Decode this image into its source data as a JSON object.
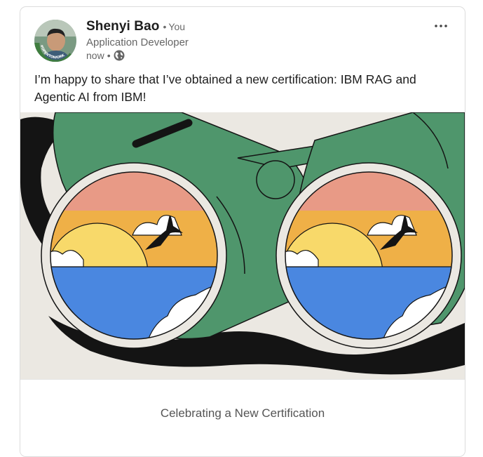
{
  "post": {
    "author": {
      "name": "Shenyi Bao",
      "separator": "•",
      "relation": "You",
      "headline": "Application Developer",
      "time": "now",
      "time_separator": "•",
      "visibility_icon": "globe-icon",
      "avatar_frame_text": "#OPENTOWORK"
    },
    "menu_icon": "more-horizontal-icon",
    "text": "I’m happy to share that I’ve obtained a new certification: IBM RAG and Agentic AI from IBM!",
    "image": {
      "icon": "binoculars-illustration"
    },
    "caption": "Celebrating a New Certification"
  },
  "colors": {
    "binocular_green": "#4f966c",
    "sky_pink": "#e89a86",
    "sun_yellow": "#f8d96a",
    "sky_orange": "#efb047",
    "water_blue": "#4a87e0",
    "background_cream": "#ebe8e2",
    "open_to_work_green": "#3f7d3f"
  }
}
